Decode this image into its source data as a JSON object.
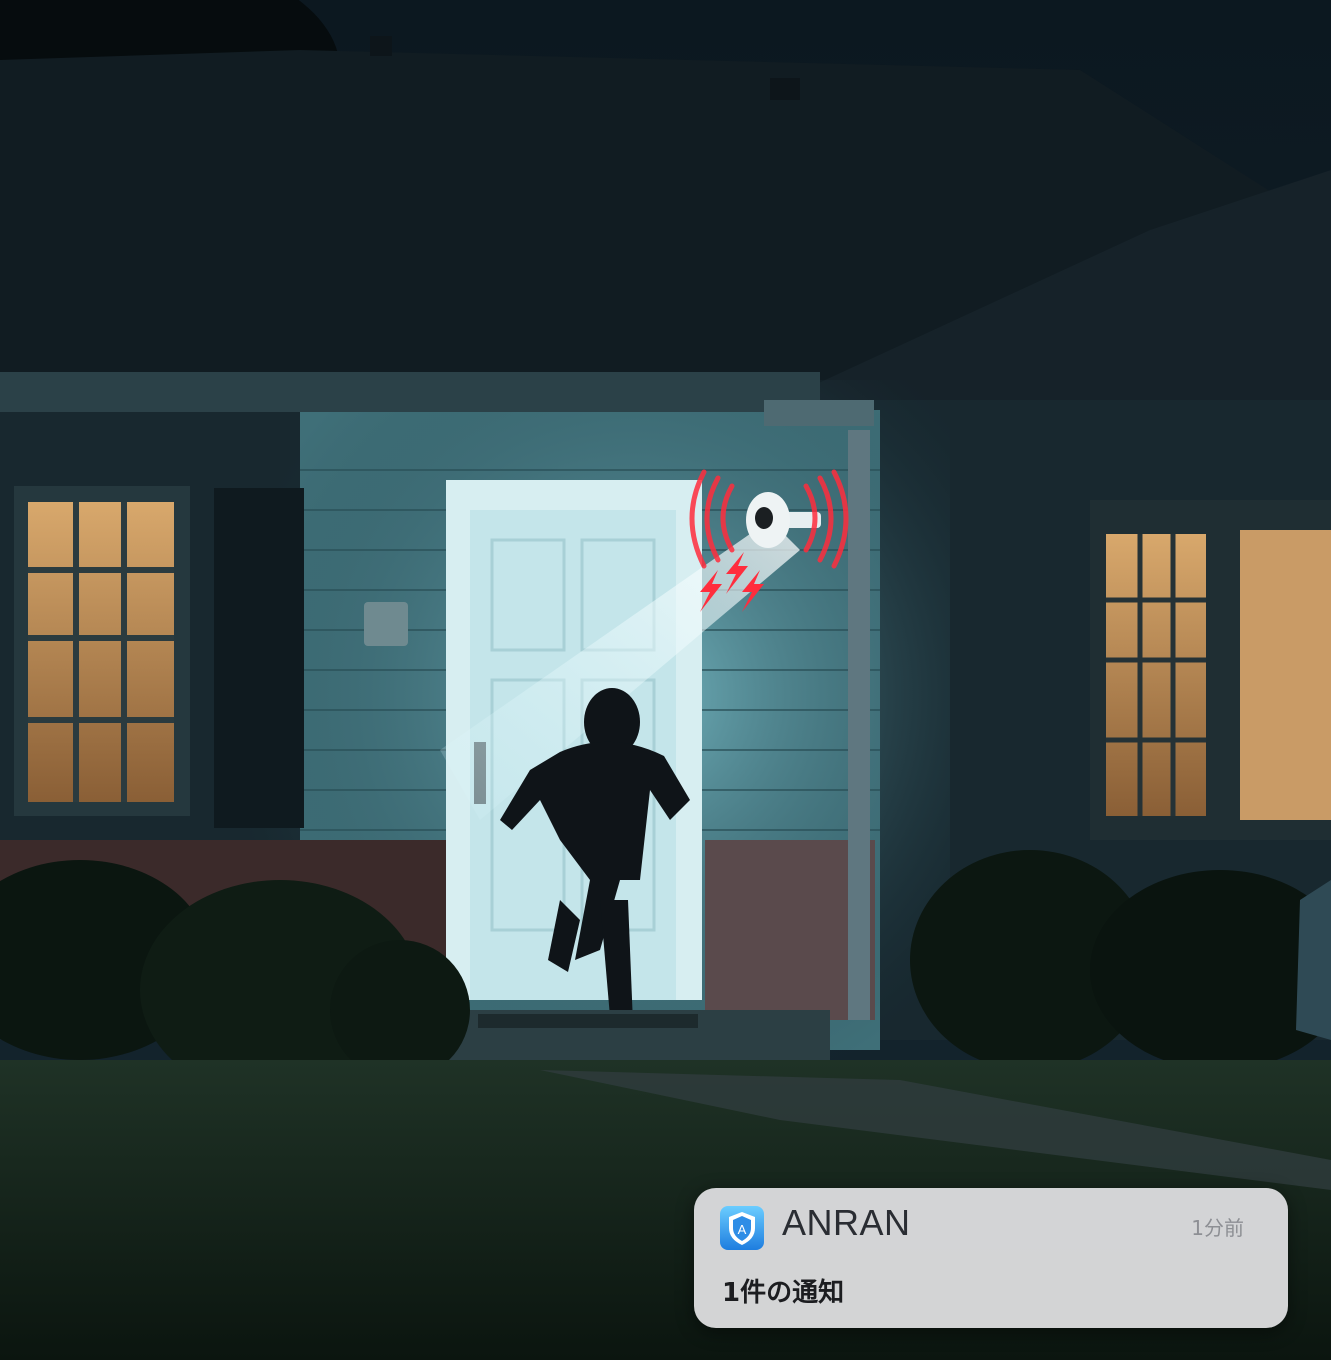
{
  "notification": {
    "app_name": "ANRAN",
    "time": "1分前",
    "message": "1件の通知",
    "icon": "shield-a-icon"
  },
  "colors": {
    "sky": "#0e1a22",
    "porch_light": "#bfeef4",
    "alert_red": "#ff2d3d",
    "window_glow": "#d9a870"
  }
}
